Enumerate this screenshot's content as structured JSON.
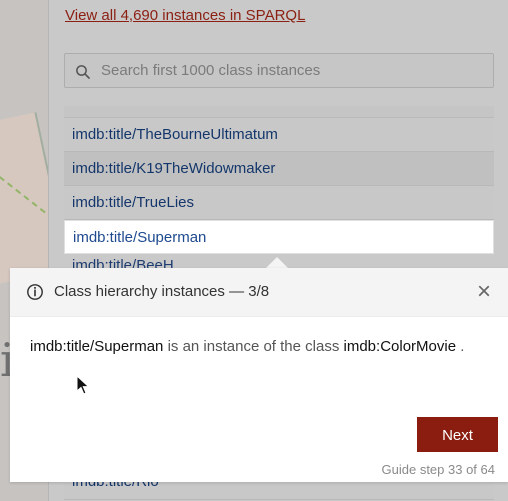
{
  "panel": {
    "sparql_link": "View all 4,690 instances in SPARQL",
    "search": {
      "placeholder": "Search first 1000 class instances"
    },
    "instances": [
      {
        "label": "imdb:title/TheBourneUltimatum"
      },
      {
        "label": "imdb:title/K19TheWidowmaker"
      },
      {
        "label": "imdb:title/TrueLies"
      },
      {
        "label": "imdb:title/Superman"
      },
      {
        "label": "imdb:title/Rio"
      }
    ],
    "partial_row_label": "imdb:title/BeeH"
  },
  "popover": {
    "title": "Class hierarchy instances — 3/8",
    "message": {
      "instance": "imdb:title/Superman",
      "middle": " is an instance of the class ",
      "class": "imdb:ColorMovie",
      "end": "."
    },
    "next_label": "Next",
    "step_text": "Guide step 33 of 64"
  },
  "colors": {
    "accent": "#8a1d10",
    "link": "#8b1f12",
    "instance_text": "#14366b"
  },
  "icons": {
    "search": "search-icon",
    "info": "info-icon",
    "close": "close-icon",
    "cursor": "mouse-pointer-icon"
  }
}
